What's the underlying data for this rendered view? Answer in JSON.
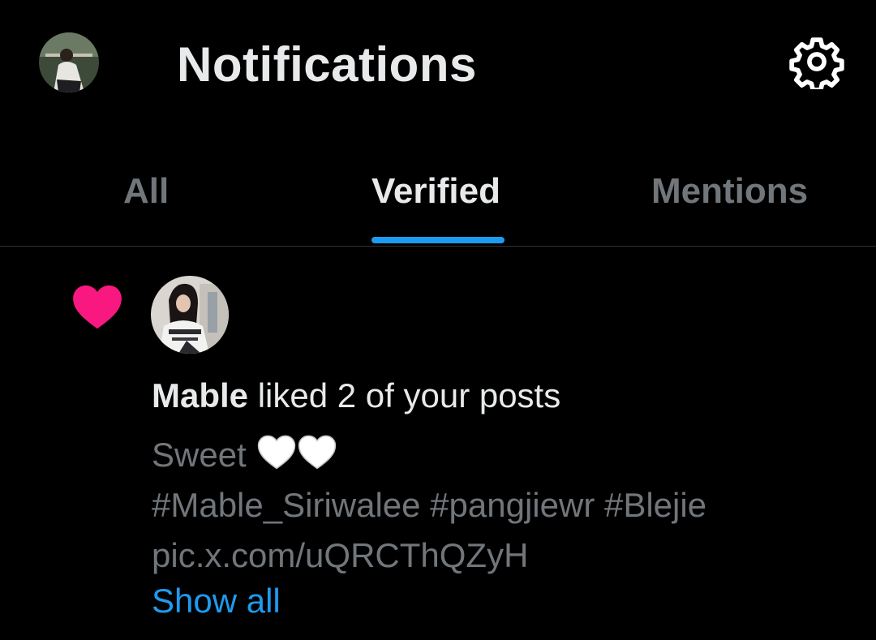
{
  "header": {
    "title": "Notifications",
    "avatar_icon": "profile-avatar",
    "settings_icon": "gear-icon"
  },
  "tabs": [
    {
      "label": "All",
      "active": false
    },
    {
      "label": "Verified",
      "active": true
    },
    {
      "label": "Mentions",
      "active": false
    }
  ],
  "notification": {
    "type_icon": "heart-icon",
    "user_name": "Mable",
    "action": " liked 2 of your posts",
    "post_text": "Sweet",
    "post_emoji": "🤍🤍",
    "hashtags": "#Mable_Siriwalee #pangjiewr #Blejie",
    "link": "pic.x.com/uQRCThQZyH",
    "show_all_label": "Show all"
  },
  "colors": {
    "background": "#000000",
    "text_primary": "#e7e9ea",
    "text_secondary": "#71767b",
    "accent": "#1d9bf0",
    "like": "#f91880",
    "divider": "#2f3336"
  }
}
